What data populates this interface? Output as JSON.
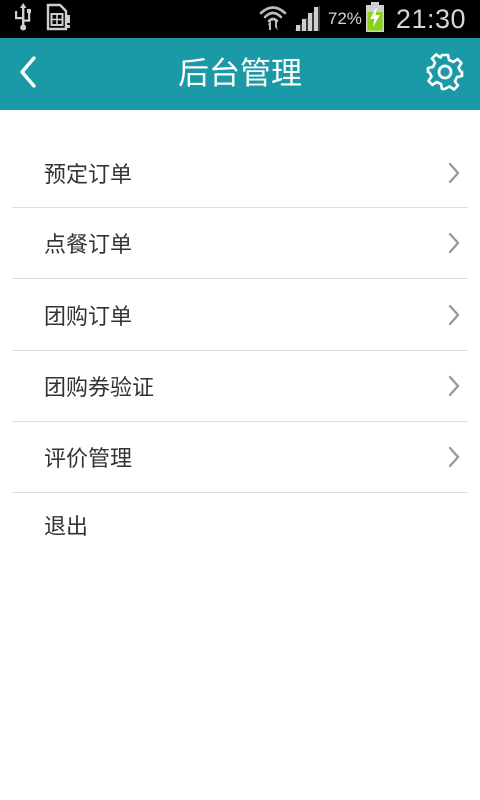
{
  "status_bar": {
    "battery_percent": "72%",
    "time": "21:30",
    "icons": [
      "usb-icon",
      "sim-card-icon",
      "wifi-icon",
      "signal-icon",
      "battery-charging-icon"
    ]
  },
  "header": {
    "title": "后台管理",
    "back_icon": "chevron-left-icon",
    "settings_icon": "gear-icon",
    "background_color": "#1a9aa6"
  },
  "menu": {
    "items": [
      {
        "label": "预定订单",
        "has_chevron": true
      },
      {
        "label": "点餐订单",
        "has_chevron": true
      },
      {
        "label": "团购订单",
        "has_chevron": true
      },
      {
        "label": "团购券验证",
        "has_chevron": true
      },
      {
        "label": "评价管理",
        "has_chevron": true
      },
      {
        "label": "退出",
        "has_chevron": false
      }
    ]
  }
}
